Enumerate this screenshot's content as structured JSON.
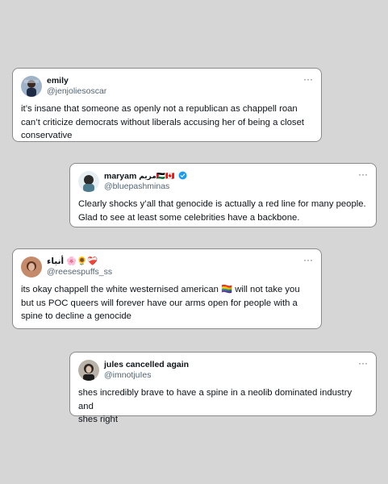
{
  "posts": [
    {
      "name": "emily",
      "handle": "@jenjoliesoscar",
      "more": "···",
      "lines": [
        "it’s insane that someone as openly not a republican as chappell roan",
        "can’t criticize democrats without liberals accusing her of being a closet",
        "conservative"
      ]
    },
    {
      "name": "maryam",
      "name_extra": "مريم🇵🇸🇨🇦",
      "handle": "@bluepashminas",
      "more": "···",
      "lines": [
        "Clearly shocks y’all that genocide is actually a red line for many people.",
        "Glad to see at least some celebrities have a backbone."
      ]
    },
    {
      "name": "أنباء 🌸🌻❤️‍🩹",
      "handle": "@reesespuffs_ss",
      "more": "···",
      "lines": [
        "its okay chappell the white westernised american 🏳️‍🌈 will not take you",
        "but us POC  queers will forever have our arms open for people with a",
        "spine to decline a genocide"
      ]
    },
    {
      "name": "jules cancelled again",
      "handle": "@imnotjuIes",
      "more": "···",
      "lines": [
        "shes incredibly brave to have a spine in a neolib dominated industry and",
        "shes right"
      ]
    }
  ],
  "colors": {
    "background": "#d6d6d6",
    "verified": "#1d9bf0",
    "handle": "#536471"
  }
}
